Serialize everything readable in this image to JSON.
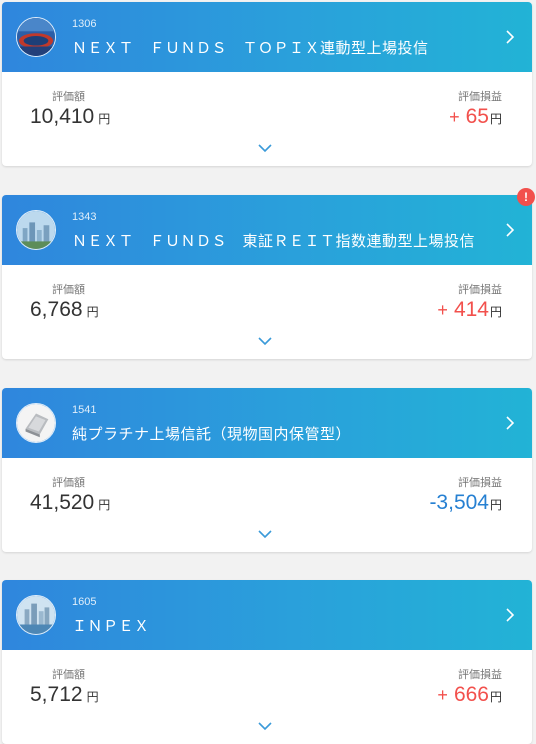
{
  "labels": {
    "valuation": "評価額",
    "gain_loss": "評価損益",
    "yen": "円"
  },
  "colors": {
    "header_gradient_start": "#2f86dd",
    "header_gradient_end": "#22b3d6",
    "gain": "#f2504c",
    "loss": "#2680d2",
    "alert": "#f2504c"
  },
  "holdings": [
    {
      "code": "1306",
      "name": "ＮＥＸＴ　ＦＵＮＤＳ　ＴＯＰＩＸ連動型上場投信",
      "icon": "stadium-photo-icon",
      "valuation": "10,410",
      "gain_sign": "+",
      "gain_value": "65",
      "gain_status": "positive",
      "has_alert": false
    },
    {
      "code": "1343",
      "name": "ＮＥＸＴ　ＦＵＮＤＳ　東証ＲＥＩＴ指数連動型上場投信",
      "icon": "city-skyline-photo-icon",
      "valuation": "6,768",
      "gain_sign": "+",
      "gain_value": "414",
      "gain_status": "positive",
      "has_alert": true,
      "alert_text": "!"
    },
    {
      "code": "1541",
      "name": "純プラチナ上場信託（現物国内保管型）",
      "icon": "platinum-bar-photo-icon",
      "valuation": "41,520",
      "gain_sign": "",
      "gain_value": "-3,504",
      "gain_status": "negative",
      "has_alert": false
    },
    {
      "code": "1605",
      "name": "ＩＮＰＥＸ",
      "icon": "city-harbor-photo-icon",
      "valuation": "5,712",
      "gain_sign": "+",
      "gain_value": "666",
      "gain_status": "positive",
      "has_alert": false
    }
  ]
}
